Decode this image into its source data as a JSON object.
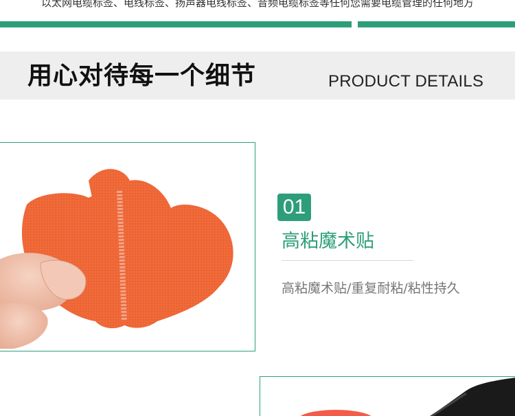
{
  "top_caption": "以太网电缆标签、电线标签、扬声器电线标签、音频电缆标签等任何您需要电缆管理的任何地方",
  "section_header": {
    "title_cn": "用心对待每一个细节",
    "title_en": "PRODUCT DETAILS"
  },
  "feature": {
    "number": "01",
    "title": "高粘魔术贴",
    "description": "高粘魔术贴/重复耐粘/粘性持久"
  },
  "colors": {
    "accent": "#2e9e7a",
    "header_band": "#eeeeee",
    "velcro": "#f06a3a"
  }
}
